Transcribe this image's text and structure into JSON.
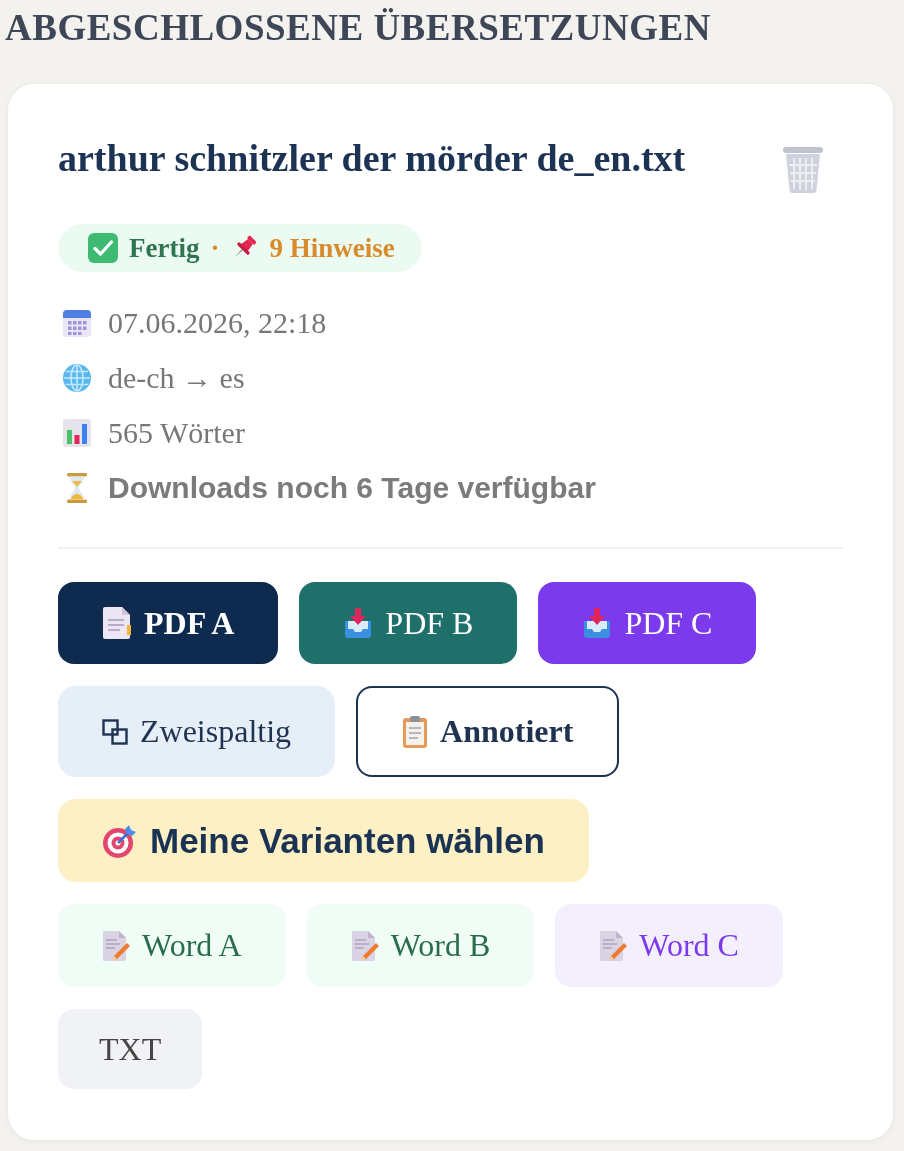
{
  "section": {
    "title": "ABGESCHLOSSENE ÜBERSETZUNGEN"
  },
  "card": {
    "file_name": "arthur schnitzler der mörder de_en.txt",
    "status": {
      "label": "Fertig",
      "separator": "·",
      "notes": "9 Hinweise"
    },
    "details": [
      {
        "kind": "date",
        "text": "07.06.2026, 22:18"
      },
      {
        "kind": "languages",
        "text": "de-ch → es"
      },
      {
        "kind": "words",
        "text": "565 Wörter"
      },
      {
        "kind": "expiry",
        "text": "Downloads noch 6 Tage verfügbar"
      }
    ],
    "action_rows": [
      {
        "buttons": [
          {
            "kind": "primary",
            "label": "PDF A",
            "color": "#0e2a4f"
          },
          {
            "kind": "export",
            "label": "PDF B",
            "color": "#1f6f6b"
          },
          {
            "kind": "export",
            "label": "PDF C",
            "color": "#7c3aed"
          }
        ]
      },
      {
        "buttons": [
          {
            "kind": "compare",
            "label": "Zweispaltig"
          },
          {
            "kind": "annotated",
            "label": "Annotiert"
          }
        ]
      },
      {
        "buttons": [
          {
            "kind": "variants",
            "label": "Meine Varianten wählen"
          }
        ]
      },
      {
        "buttons": [
          {
            "kind": "word",
            "label": "Word A",
            "color": "#2a6b4c"
          },
          {
            "kind": "word",
            "label": "Word B",
            "color": "#2a6b4c"
          },
          {
            "kind": "word",
            "label": "Word C",
            "color": "#7c3aed"
          }
        ]
      },
      {
        "buttons": [
          {
            "kind": "plain",
            "label": "TXT"
          }
        ]
      }
    ]
  }
}
